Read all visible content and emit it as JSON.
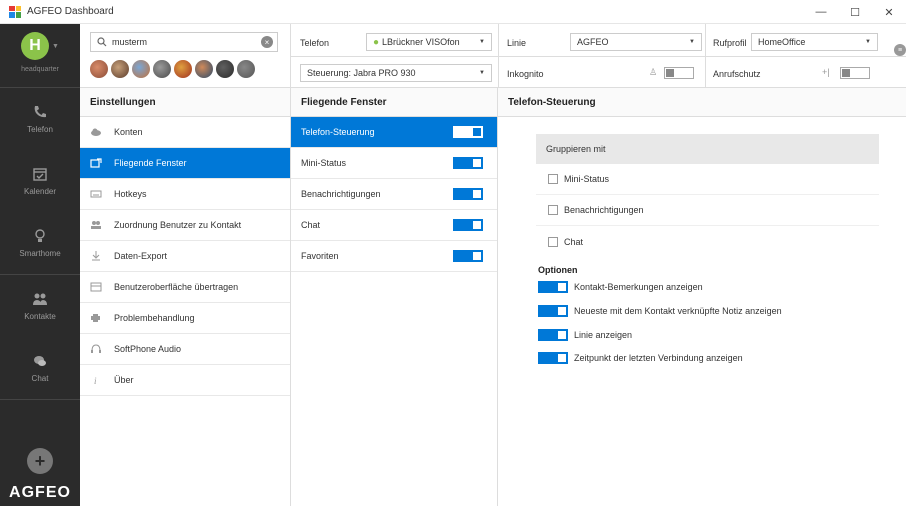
{
  "window": {
    "title": "AGFEO Dashboard",
    "minimize": "—",
    "maximize": "☐",
    "close": "✕"
  },
  "sidebar": {
    "avatar_letter": "H",
    "location": "headquarter",
    "items": [
      {
        "label": "Telefon",
        "icon": "phone-icon"
      },
      {
        "label": "Kalender",
        "icon": "calendar-icon"
      },
      {
        "label": "Smarthome",
        "icon": "bulb-icon"
      },
      {
        "label": "Kontakte",
        "icon": "contacts-icon"
      },
      {
        "label": "Chat",
        "icon": "chat-icon"
      }
    ],
    "add": "+",
    "logo": "AGFEO"
  },
  "search": {
    "value": "musterm"
  },
  "top": {
    "telefon_label": "Telefon",
    "telefon_value": "LBrückner VISOfon",
    "steuerung_value": "Steuerung: Jabra PRO 930",
    "linie_label": "Linie",
    "linie_value": "AGFEO",
    "rufprofil_label": "Rufprofil",
    "rufprofil_value": "HomeOffice",
    "inkognito_label": "Inkognito",
    "anrufschutz_label": "Anrufschutz"
  },
  "columns": {
    "einstellungen": "Einstellungen",
    "fliegende": "Fliegende Fenster",
    "telefon_steuerung": "Telefon-Steuerung"
  },
  "settings_items": [
    "Konten",
    "Fliegende Fenster",
    "Hotkeys",
    "Zuordnung Benutzer zu Kontakt",
    "Daten-Export",
    "Benutzeroberfläche übertragen",
    "Problembehandlung",
    "SoftPhone Audio",
    "Über"
  ],
  "window_items": [
    "Telefon-Steuerung",
    "Mini-Status",
    "Benachrichtigungen",
    "Chat",
    "Favoriten"
  ],
  "panel": {
    "group_title": "Gruppieren mit",
    "checkboxes": [
      "Mini-Status",
      "Benachrichtigungen",
      "Chat"
    ],
    "options_title": "Optionen",
    "options": [
      "Kontakt-Bemerkungen anzeigen",
      "Neueste mit dem Kontakt verknüpfte Notiz anzeigen",
      "Linie anzeigen",
      "Zeitpunkt der letzten Verbindung anzeigen"
    ]
  },
  "colors": {
    "accent": "#0078d7",
    "sidebar": "#2b2b2b",
    "presence_green": "#8bc34a"
  }
}
